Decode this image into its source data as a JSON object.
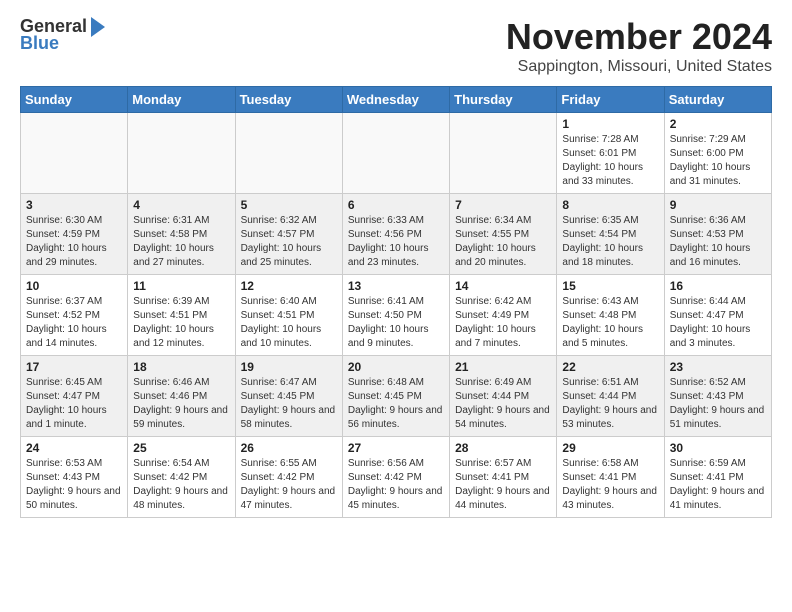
{
  "logo": {
    "general": "General",
    "blue": "Blue"
  },
  "title": "November 2024",
  "location": "Sappington, Missouri, United States",
  "headers": [
    "Sunday",
    "Monday",
    "Tuesday",
    "Wednesday",
    "Thursday",
    "Friday",
    "Saturday"
  ],
  "weeks": [
    [
      {
        "day": "",
        "info": ""
      },
      {
        "day": "",
        "info": ""
      },
      {
        "day": "",
        "info": ""
      },
      {
        "day": "",
        "info": ""
      },
      {
        "day": "",
        "info": ""
      },
      {
        "day": "1",
        "info": "Sunrise: 7:28 AM\nSunset: 6:01 PM\nDaylight: 10 hours and 33 minutes."
      },
      {
        "day": "2",
        "info": "Sunrise: 7:29 AM\nSunset: 6:00 PM\nDaylight: 10 hours and 31 minutes."
      }
    ],
    [
      {
        "day": "3",
        "info": "Sunrise: 6:30 AM\nSunset: 4:59 PM\nDaylight: 10 hours and 29 minutes."
      },
      {
        "day": "4",
        "info": "Sunrise: 6:31 AM\nSunset: 4:58 PM\nDaylight: 10 hours and 27 minutes."
      },
      {
        "day": "5",
        "info": "Sunrise: 6:32 AM\nSunset: 4:57 PM\nDaylight: 10 hours and 25 minutes."
      },
      {
        "day": "6",
        "info": "Sunrise: 6:33 AM\nSunset: 4:56 PM\nDaylight: 10 hours and 23 minutes."
      },
      {
        "day": "7",
        "info": "Sunrise: 6:34 AM\nSunset: 4:55 PM\nDaylight: 10 hours and 20 minutes."
      },
      {
        "day": "8",
        "info": "Sunrise: 6:35 AM\nSunset: 4:54 PM\nDaylight: 10 hours and 18 minutes."
      },
      {
        "day": "9",
        "info": "Sunrise: 6:36 AM\nSunset: 4:53 PM\nDaylight: 10 hours and 16 minutes."
      }
    ],
    [
      {
        "day": "10",
        "info": "Sunrise: 6:37 AM\nSunset: 4:52 PM\nDaylight: 10 hours and 14 minutes."
      },
      {
        "day": "11",
        "info": "Sunrise: 6:39 AM\nSunset: 4:51 PM\nDaylight: 10 hours and 12 minutes."
      },
      {
        "day": "12",
        "info": "Sunrise: 6:40 AM\nSunset: 4:51 PM\nDaylight: 10 hours and 10 minutes."
      },
      {
        "day": "13",
        "info": "Sunrise: 6:41 AM\nSunset: 4:50 PM\nDaylight: 10 hours and 9 minutes."
      },
      {
        "day": "14",
        "info": "Sunrise: 6:42 AM\nSunset: 4:49 PM\nDaylight: 10 hours and 7 minutes."
      },
      {
        "day": "15",
        "info": "Sunrise: 6:43 AM\nSunset: 4:48 PM\nDaylight: 10 hours and 5 minutes."
      },
      {
        "day": "16",
        "info": "Sunrise: 6:44 AM\nSunset: 4:47 PM\nDaylight: 10 hours and 3 minutes."
      }
    ],
    [
      {
        "day": "17",
        "info": "Sunrise: 6:45 AM\nSunset: 4:47 PM\nDaylight: 10 hours and 1 minute."
      },
      {
        "day": "18",
        "info": "Sunrise: 6:46 AM\nSunset: 4:46 PM\nDaylight: 9 hours and 59 minutes."
      },
      {
        "day": "19",
        "info": "Sunrise: 6:47 AM\nSunset: 4:45 PM\nDaylight: 9 hours and 58 minutes."
      },
      {
        "day": "20",
        "info": "Sunrise: 6:48 AM\nSunset: 4:45 PM\nDaylight: 9 hours and 56 minutes."
      },
      {
        "day": "21",
        "info": "Sunrise: 6:49 AM\nSunset: 4:44 PM\nDaylight: 9 hours and 54 minutes."
      },
      {
        "day": "22",
        "info": "Sunrise: 6:51 AM\nSunset: 4:44 PM\nDaylight: 9 hours and 53 minutes."
      },
      {
        "day": "23",
        "info": "Sunrise: 6:52 AM\nSunset: 4:43 PM\nDaylight: 9 hours and 51 minutes."
      }
    ],
    [
      {
        "day": "24",
        "info": "Sunrise: 6:53 AM\nSunset: 4:43 PM\nDaylight: 9 hours and 50 minutes."
      },
      {
        "day": "25",
        "info": "Sunrise: 6:54 AM\nSunset: 4:42 PM\nDaylight: 9 hours and 48 minutes."
      },
      {
        "day": "26",
        "info": "Sunrise: 6:55 AM\nSunset: 4:42 PM\nDaylight: 9 hours and 47 minutes."
      },
      {
        "day": "27",
        "info": "Sunrise: 6:56 AM\nSunset: 4:42 PM\nDaylight: 9 hours and 45 minutes."
      },
      {
        "day": "28",
        "info": "Sunrise: 6:57 AM\nSunset: 4:41 PM\nDaylight: 9 hours and 44 minutes."
      },
      {
        "day": "29",
        "info": "Sunrise: 6:58 AM\nSunset: 4:41 PM\nDaylight: 9 hours and 43 minutes."
      },
      {
        "day": "30",
        "info": "Sunrise: 6:59 AM\nSunset: 4:41 PM\nDaylight: 9 hours and 41 minutes."
      }
    ]
  ]
}
